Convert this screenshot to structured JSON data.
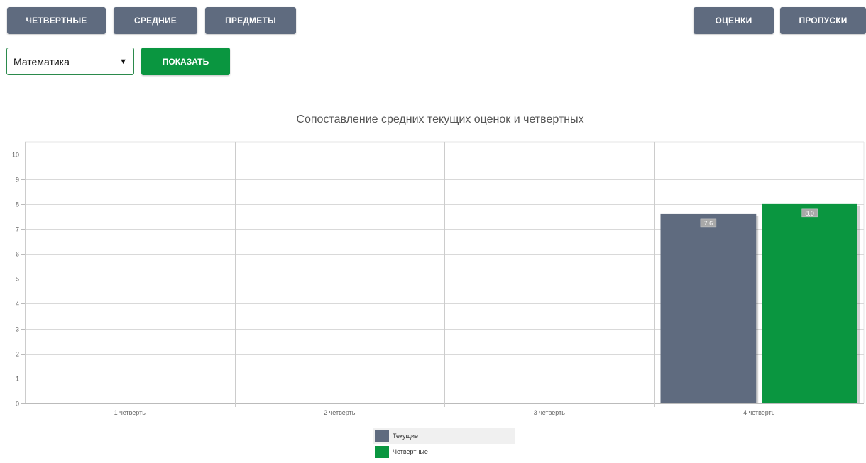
{
  "toolbar": {
    "quarter_label": "ЧЕТВЕРТНЫЕ",
    "average_label": "СРЕДНИЕ",
    "subjects_label": "ПРЕДМЕТЫ",
    "marks_label": "ОЦЕНКИ",
    "absences_label": "ПРОПУСКИ"
  },
  "filter": {
    "subject_value": "Математика",
    "show_label": "ПОКАЗАТЬ"
  },
  "colors": {
    "button": "#5f6b7f",
    "accent_green": "#0a9640",
    "series_current": "#5f6b7f",
    "series_quarter": "#0a9640"
  },
  "chart_data": {
    "type": "bar",
    "title": "Сопоставление средних текущих оценок и четвертных",
    "categories": [
      "1 четверть",
      "2 четверть",
      "3 четверть",
      "4 четверть"
    ],
    "series": [
      {
        "name": "Текущие",
        "values": [
          null,
          null,
          null,
          7.6
        ]
      },
      {
        "name": "Четвертные",
        "values": [
          null,
          null,
          null,
          8.0
        ]
      }
    ],
    "data_labels": [
      {
        "series": 0,
        "category": 3,
        "text": "7.6"
      },
      {
        "series": 1,
        "category": 3,
        "text": "8.0"
      }
    ],
    "yticks": [
      "0",
      "1",
      "2",
      "3",
      "4",
      "5",
      "6",
      "7",
      "8",
      "9",
      "10"
    ],
    "ylim": [
      0,
      10.5
    ],
    "grid": true,
    "legend_position": "bottom"
  }
}
